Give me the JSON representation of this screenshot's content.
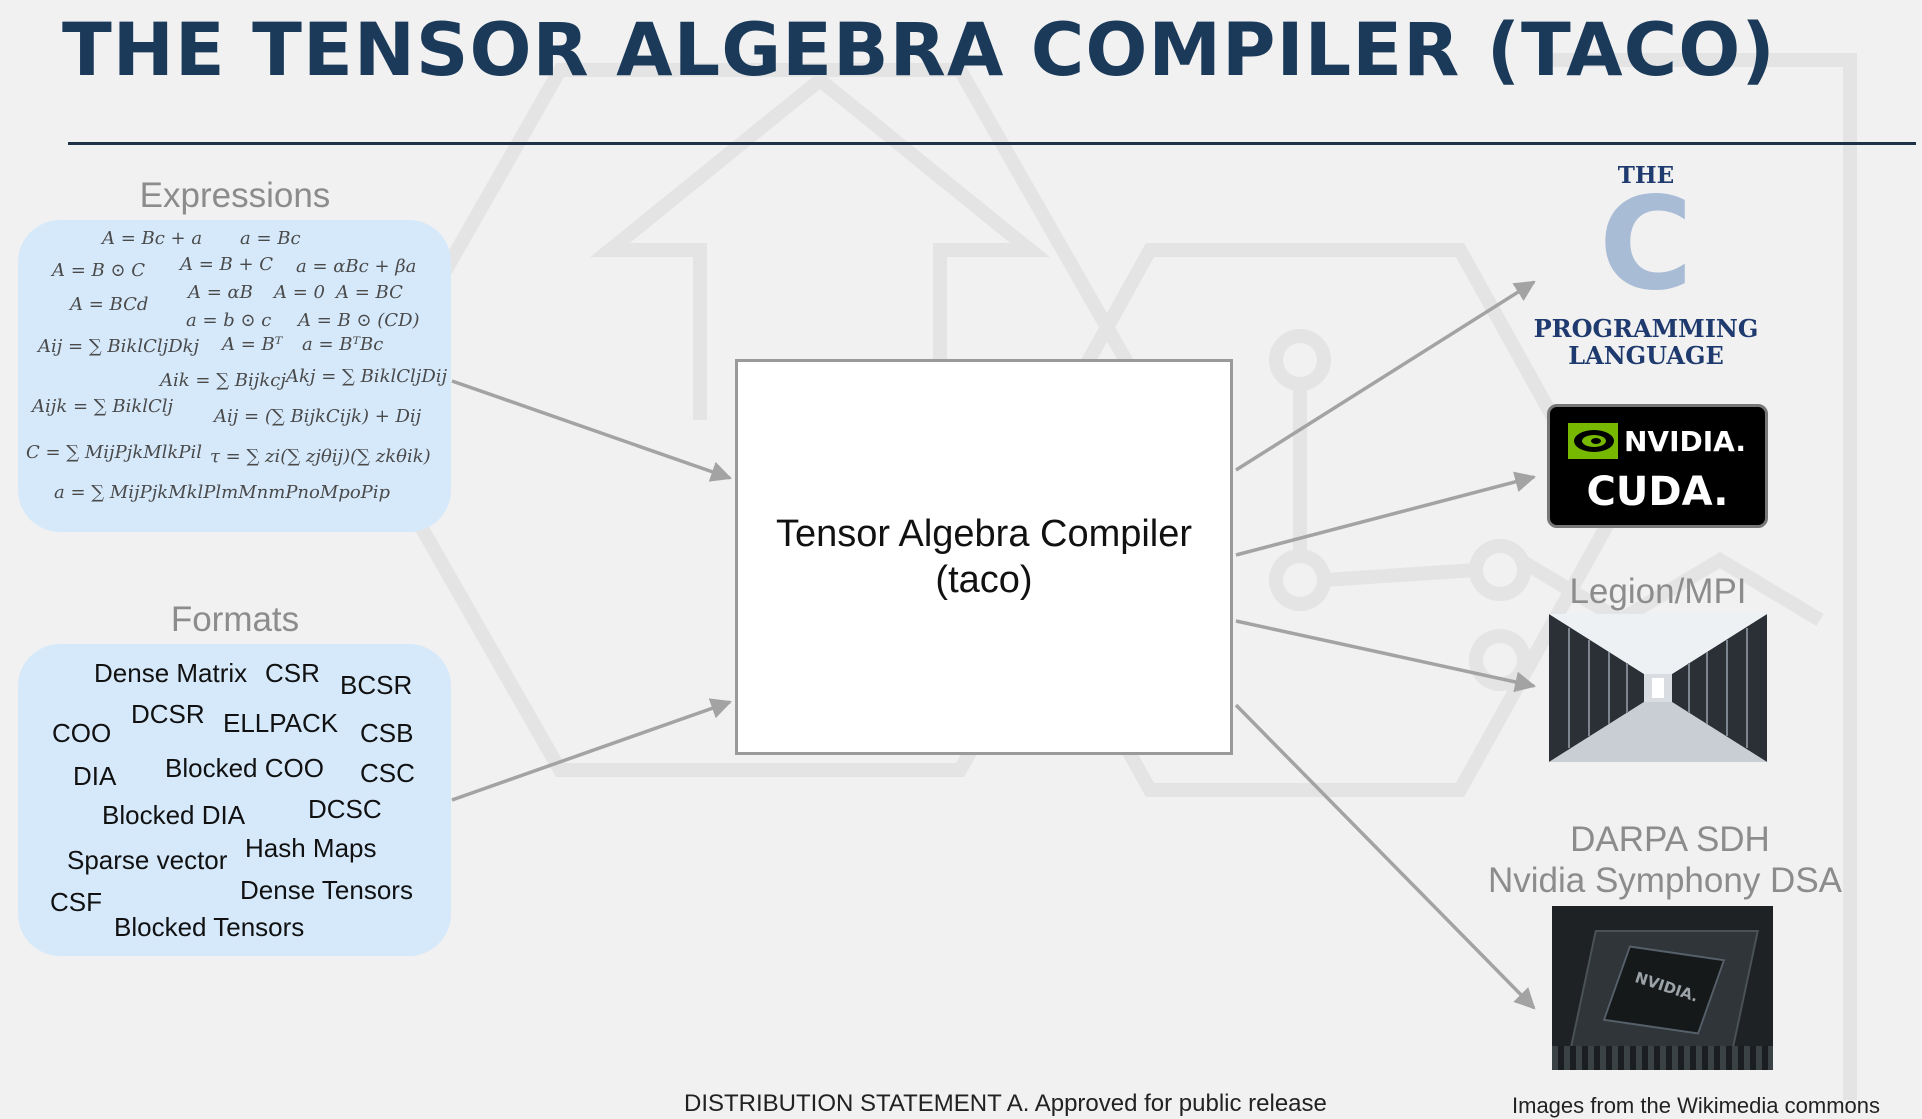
{
  "title": "THE TENSOR ALGEBRA COMPILER (TACO)",
  "expressions": {
    "label": "Expressions",
    "items": [
      "A = Bc + a",
      "a = Bc",
      "A = B ⊙ C",
      "A = B + C",
      "a = αBc + βa",
      "A = BCd",
      "A = αB",
      "A = 0",
      "A = BC",
      "a = b ⊙ c",
      "A = B ⊙ (CD)",
      "Aij = ∑ BiklCljDkj",
      "A = Bᵀ",
      "a = BᵀBc",
      "Aik = ∑ Bijkcj",
      "Akj = ∑ BiklCljDij",
      "Aijk = ∑ BiklClj",
      "Aij = (∑ BijkCijk) + Dij",
      "C = ∑ MijPjkMlkPil",
      "τ = ∑ zi(∑ zjθij)(∑ zkθik)",
      "a = ∑ MijPjkMklPlmMnmPnoMpoPip"
    ]
  },
  "formats": {
    "label": "Formats",
    "items": [
      "Dense Matrix",
      "CSR",
      "BCSR",
      "COO",
      "DCSR",
      "ELLPACK",
      "CSB",
      "DIA",
      "Blocked COO",
      "CSC",
      "Blocked DIA",
      "DCSC",
      "Sparse vector",
      "Hash Maps",
      "CSF",
      "Dense Tensors",
      "Blocked Tensors"
    ]
  },
  "compiler": {
    "line1": "Tensor Algebra Compiler",
    "line2": "(taco)"
  },
  "targets": {
    "c_logo": {
      "the": "THE",
      "letter": "C",
      "line1": "PROGRAMMING",
      "line2": "LANGUAGE"
    },
    "cuda_logo": {
      "brand": "NVIDIA.",
      "product": "CUDA."
    },
    "legion": "Legion/MPI",
    "darpa_line1": "DARPA SDH",
    "darpa_line2": "Nvidia Symphony DSA",
    "chip_text": "NVIDIA."
  },
  "footer": {
    "distribution": "DISTRIBUTION STATEMENT A. Approved for public release",
    "credits": "Images from the Wikimedia commons"
  },
  "colors": {
    "title": "#1b3a5a",
    "panel": "#d6e9fb",
    "arrow": "#a3a3a3",
    "c_logo": "#1e3a6e",
    "c_letter": "#a9bcd6",
    "nvidia_green": "#76b900"
  }
}
